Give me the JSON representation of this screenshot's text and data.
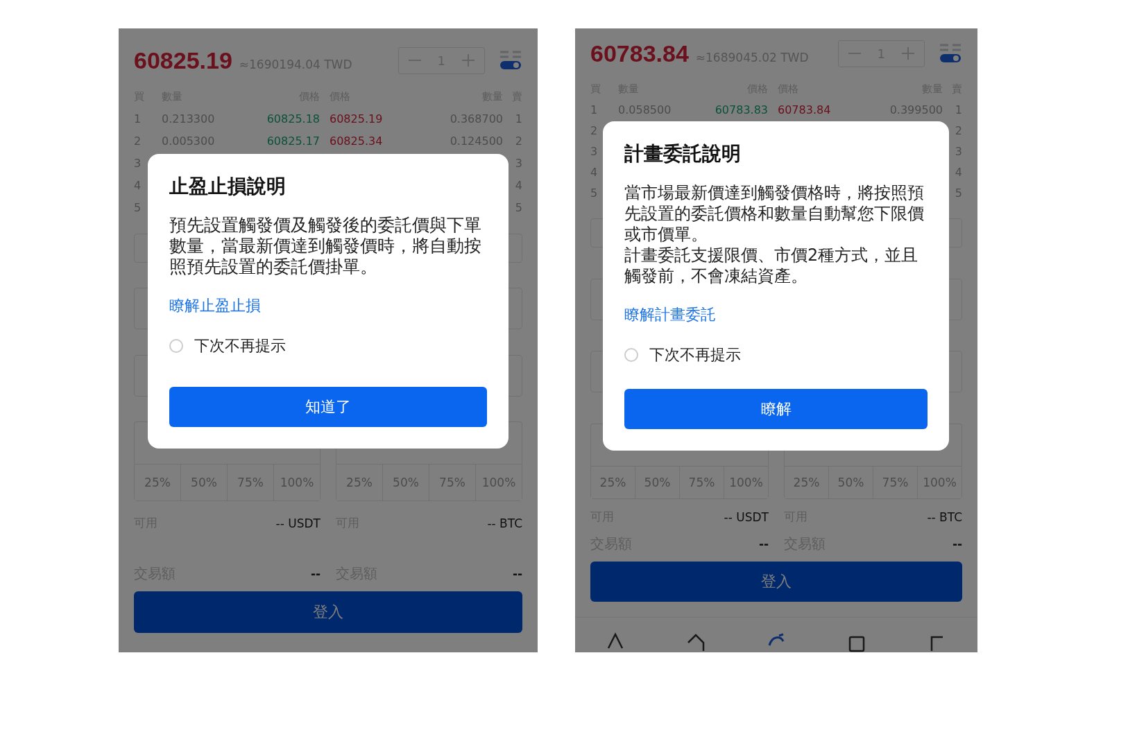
{
  "phones": [
    {
      "price": "60825.19",
      "approx": "≈1690194.04 TWD",
      "stepper_value": "1",
      "book_header": [
        "買",
        "數量",
        "價格",
        "價格",
        "數量",
        "賣"
      ],
      "book_rows": [
        {
          "bid_index": "1",
          "bid_qty": "0.213300",
          "bid_price": "60825.18",
          "ask_price": "60825.19",
          "ask_qty": "0.368700",
          "ask_index": "1"
        },
        {
          "bid_index": "2",
          "bid_qty": "0.005300",
          "bid_price": "60825.17",
          "ask_price": "60825.34",
          "ask_qty": "0.124500",
          "ask_index": "2"
        },
        {
          "bid_index": "3",
          "ask_index": "3"
        },
        {
          "bid_index": "4",
          "ask_index": "4"
        },
        {
          "bid_index": "5",
          "ask_index": "5"
        }
      ],
      "sides": [
        {
          "percents": [
            "25%",
            "50%",
            "75%",
            "100%"
          ],
          "available_label": "可用",
          "available_value": "-- USDT",
          "amount_label": "交易額",
          "amount_value": "--"
        },
        {
          "percents": [
            "25%",
            "50%",
            "75%",
            "100%"
          ],
          "available_label": "可用",
          "available_value": "-- BTC",
          "amount_label": "交易額",
          "amount_value": "--"
        }
      ],
      "login_button": "登入",
      "dialog": {
        "title": "止盈止損說明",
        "paragraphs": [
          "預先設置觸發價及觸發後的委託價與下單數量，當最新價達到觸發價時，將自動按照預先設置的委託價掛單。"
        ],
        "link": "瞭解止盈止損",
        "dont_show": {
          "label": "下次不再提示",
          "checked": false
        },
        "button": "知道了"
      }
    },
    {
      "price": "60783.84",
      "approx": "≈1689045.02 TWD",
      "stepper_value": "1",
      "book_header": [
        "買",
        "數量",
        "價格",
        "價格",
        "數量",
        "賣"
      ],
      "book_rows": [
        {
          "bid_index": "1",
          "bid_qty": "0.058500",
          "bid_price": "60783.83",
          "ask_price": "60783.84",
          "ask_qty": "0.399500",
          "ask_index": "1"
        },
        {
          "bid_index": "2",
          "ask_index": "2"
        },
        {
          "bid_index": "3",
          "ask_index": "3"
        },
        {
          "bid_index": "4",
          "ask_index": "4"
        },
        {
          "bid_index": "5",
          "ask_index": "5"
        }
      ],
      "sides": [
        {
          "percents": [
            "25%",
            "50%",
            "75%",
            "100%"
          ],
          "available_label": "可用",
          "available_value": "-- USDT",
          "amount_label": "交易額",
          "amount_value": "--"
        },
        {
          "percents": [
            "25%",
            "50%",
            "75%",
            "100%"
          ],
          "available_label": "可用",
          "available_value": "-- BTC",
          "amount_label": "交易額",
          "amount_value": "--"
        }
      ],
      "login_button": "登入",
      "nav": [
        {
          "kind": "triangle",
          "selected": false
        },
        {
          "kind": "house",
          "selected": false
        },
        {
          "kind": "swirl",
          "selected": true
        },
        {
          "kind": "square",
          "selected": false
        },
        {
          "kind": "page",
          "selected": false
        }
      ],
      "dialog": {
        "title": "計畫委託說明",
        "paragraphs": [
          "當市場最新價達到觸發價格時，將按照預先設置的委託價格和數量自動幫您下限價或市價單。",
          "計畫委託支援限價、市價2種方式，並且觸發前，不會凍結資產。"
        ],
        "link": "瞭解計畫委託",
        "dont_show": {
          "label": "下次不再提示",
          "checked": false
        },
        "button": "瞭解"
      }
    }
  ]
}
